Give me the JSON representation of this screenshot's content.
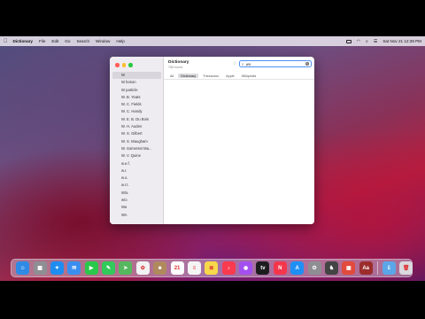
{
  "menubar": {
    "apple": "",
    "items": [
      "Dictionary",
      "File",
      "Edit",
      "Go",
      "Search",
      "Window",
      "Help"
    ],
    "clock": "Sat Nov 21  12:29 PM"
  },
  "window": {
    "title": "Dictionary",
    "subtitle": "768 found",
    "search": {
      "value": "wo"
    },
    "tabs": [
      "All",
      "Dictionary",
      "Thesaurus",
      "Apple",
      "Wikipedia"
    ],
    "active_tab": "Dictionary",
    "words": [
      "W",
      "W boson",
      "W particle",
      "W. B. Yeats",
      "W. C. Fields",
      "W. C. Handy",
      "W. E. B. Du Bois",
      "W. H. Auden",
      "W. S. Gilbert",
      "W. S. Maugham",
      "W. Somerset Ma...",
      "W. V. Quine",
      "w.e.f.",
      "w.r.",
      "w.o.",
      "w.r.t.",
      "W/a",
      "w/o",
      "Wa",
      "WA"
    ]
  },
  "dock": {
    "icons": [
      {
        "name": "finder-icon",
        "color": "#2f8ae5",
        "glyph": "☺"
      },
      {
        "name": "launchpad-icon",
        "color": "#8e8e93",
        "glyph": "▦"
      },
      {
        "name": "safari-icon",
        "color": "#1e8cf0",
        "glyph": "✦"
      },
      {
        "name": "mail-icon",
        "color": "#3a8ef0",
        "glyph": "✉"
      },
      {
        "name": "facetime-icon",
        "color": "#2ac84a",
        "glyph": "▶"
      },
      {
        "name": "messages-icon",
        "color": "#32c95a",
        "glyph": "✎"
      },
      {
        "name": "maps-icon",
        "color": "#56b85e",
        "glyph": "➤"
      },
      {
        "name": "photos-icon",
        "color": "#f2f2f2",
        "glyph": "✿"
      },
      {
        "name": "contacts-icon",
        "color": "#b08a5e",
        "glyph": "☻"
      },
      {
        "name": "calendar-icon",
        "color": "#ffffff",
        "glyph": "21"
      },
      {
        "name": "reminders-icon",
        "color": "#f4f4f4",
        "glyph": "≡"
      },
      {
        "name": "notes-icon",
        "color": "#f7d84a",
        "glyph": "≣"
      },
      {
        "name": "music-icon",
        "color": "#fa3a4e",
        "glyph": "♪"
      },
      {
        "name": "podcasts-icon",
        "color": "#a34ff0",
        "glyph": "◉"
      },
      {
        "name": "apple-tv-icon",
        "color": "#1c1c1e",
        "glyph": "tv"
      },
      {
        "name": "news-icon",
        "color": "#f4364c",
        "glyph": "N"
      },
      {
        "name": "app-store-icon",
        "color": "#1e90f5",
        "glyph": "A"
      },
      {
        "name": "system-preferences-icon",
        "color": "#8e8e93",
        "glyph": "⚙"
      },
      {
        "name": "chess-icon",
        "color": "#444444",
        "glyph": "♞"
      },
      {
        "name": "preview-icon",
        "color": "#e14a3c",
        "glyph": "▣"
      },
      {
        "name": "dictionary-icon",
        "color": "#9b2d2d",
        "glyph": "Aa"
      },
      {
        "name": "downloads-folder-icon",
        "color": "#5aa6e8",
        "glyph": "⇩"
      },
      {
        "name": "trash-icon",
        "color": "#d9d9de",
        "glyph": "🗑"
      }
    ]
  }
}
